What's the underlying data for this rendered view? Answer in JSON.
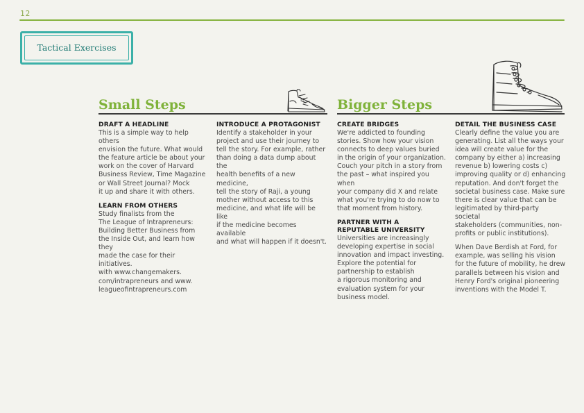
{
  "page_number": "12",
  "section_label": "Tactical Exercises",
  "small_steps": {
    "heading": "Small Steps",
    "col1": {
      "block1_title": "DRAFT A HEADLINE",
      "block1_body": "This is a simple way to help others\nenvision the future. What would\nthe feature article be about your\nwork on the cover of Harvard\nBusiness Review, Time Magazine\nor Wall Street Journal? Mock\nit up and share it with others.",
      "block2_title": "LEARN FROM OTHERS",
      "block2_body": "Study finalists from the\nThe League of Intrapreneurs:\nBuilding Better Business from\nthe Inside Out, and learn how they\nmade the case for their initiatives.\nwith www.changemakers.\ncom/intrapreneurs and www.\nleagueofintrapreneurs.com"
    },
    "col2": {
      "block1_title": "INTRODUCE A PROTAGONIST",
      "block1_body": "Identify a stakeholder in your\nproject and use their journey to\ntell the story. For example, rather\nthan doing a data dump about the\nhealth benefits of a new medicine,\ntell the story of Raji, a young\nmother without access to this\nmedicine, and what life will be like\nif the medicine becomes available\nand what will happen if it doesn't."
    }
  },
  "bigger_steps": {
    "heading": "Bigger Steps",
    "col1": {
      "block1_title": "CREATE BRIDGES",
      "block1_body": "We're addicted to founding\nstories. Show how your vision\nconnects to deep values buried\nin the origin of your organization.\nCouch your pitch in a story from\nthe past – what inspired you when\nyour company did X and relate\nwhat you're trying to do now to\nthat moment from history.",
      "block2_title": "PARTNER WITH A\nREPUTABLE UNIVERSITY",
      "block2_body": "Universities are increasingly\ndeveloping expertise in social\ninnovation and impact investing.\nExplore the potential for\npartnership to establish\na rigorous monitoring and\nevaluation system for your\nbusiness model."
    },
    "col2": {
      "block1_title": "DETAIL THE BUSINESS CASE",
      "block1_body": "Clearly define the value you are\ngenerating. List all the ways your\nidea will create value for the\ncompany by either a) increasing\nrevenue b) lowering costs c)\nimproving quality or d) enhancing\nreputation.  And don't forget the\nsocietal business case. Make sure\nthere is clear value that can be\nlegitimated by third-party societal\nstakeholders (communities, non-\nprofits or public institutions).",
      "block2_body": "When Dave Berdish at Ford, for\nexample, was selling his vision\nfor the future of mobility, he drew\nparallels between his vision and\nHenry Ford's original pioneering\ninventions with the Model T."
    }
  },
  "colors": {
    "accent_green": "#7fb23a",
    "stamp_teal": "#3bb0a8"
  },
  "icons": [
    "sneaker-icon",
    "hiking-boot-icon"
  ]
}
